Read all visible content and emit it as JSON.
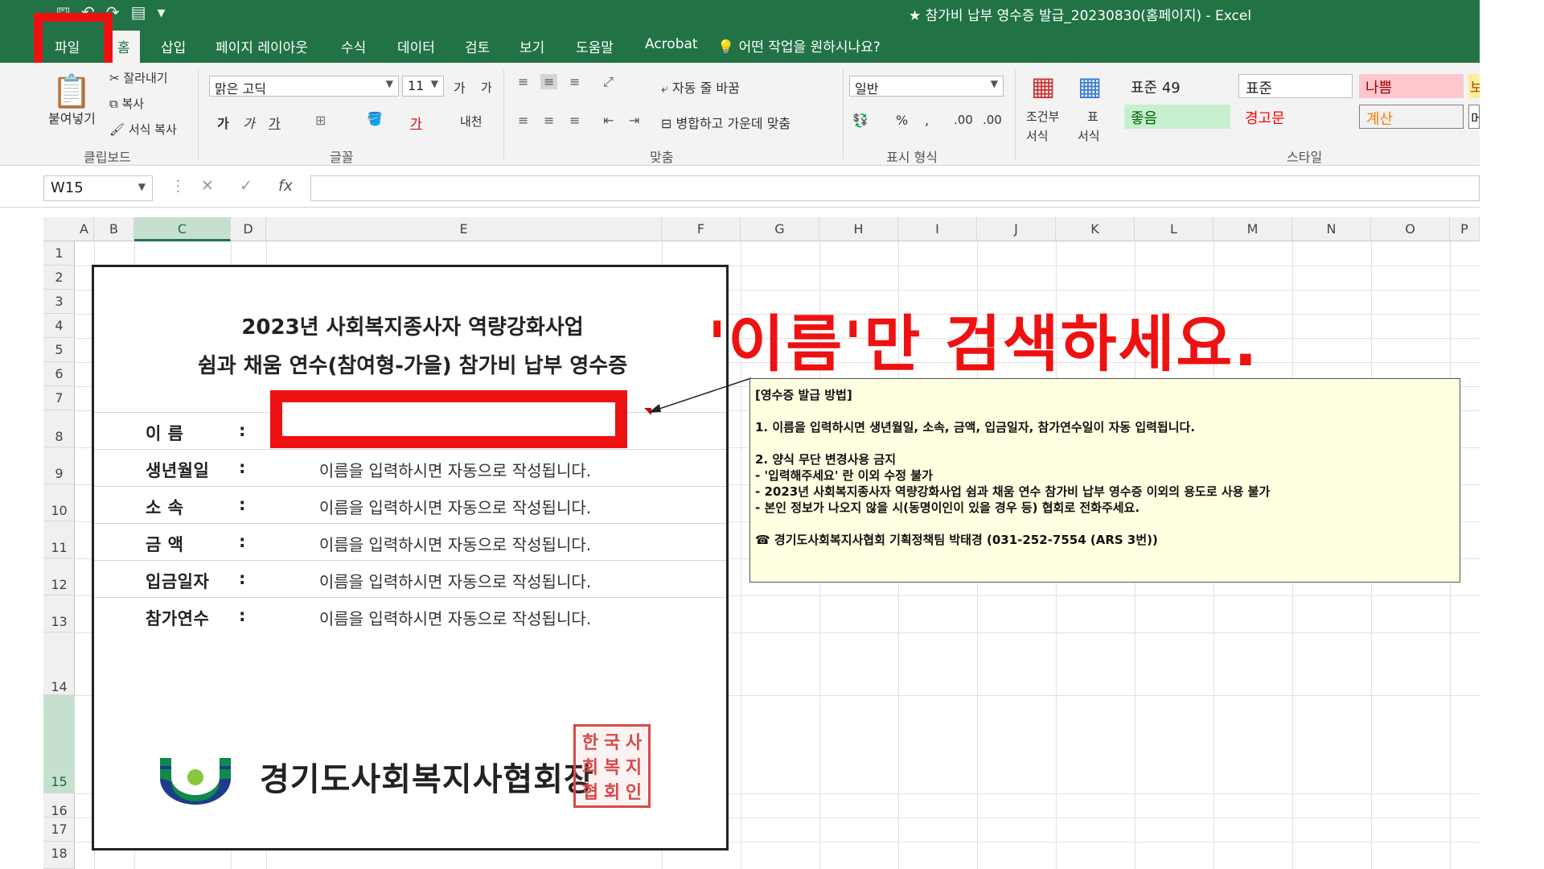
{
  "app": {
    "title": "★ 참가비 납부 영수증 발급_20230830(홈페이지)  -  Excel"
  },
  "tabs": [
    {
      "label": "파일"
    },
    {
      "label": "홈"
    },
    {
      "label": "삽입"
    },
    {
      "label": "페이지 레이아웃"
    },
    {
      "label": "수식"
    },
    {
      "label": "데이터"
    },
    {
      "label": "검토"
    },
    {
      "label": "보기"
    },
    {
      "label": "도움말"
    },
    {
      "label": "Acrobat"
    }
  ],
  "tell_me": "어떤 작업을 원하시나요?",
  "ribbon": {
    "clipboard": {
      "paste": "붙여넣기",
      "cut": "잘라내기",
      "copy": "복사",
      "format_painter": "서식 복사",
      "group": "클립보드"
    },
    "font": {
      "name": "맑은 고딕",
      "size": "11",
      "grow": "가",
      "shrink": "가",
      "bold": "가",
      "italic": "가",
      "underline": "가",
      "font_color": "가",
      "phonetic": "내천",
      "group": "글꼴"
    },
    "alignment": {
      "wrap": "자동 줄 바꿈",
      "merge": "병합하고 가운데 맞춤",
      "group": "맞춤"
    },
    "number": {
      "format": "일반",
      "percent": "%",
      "comma": ",",
      "increase_decimal": ".00",
      "decrease_decimal": ".00",
      "group": "표시 형식"
    },
    "styles": {
      "conditional": "조건부",
      "conditional2": "서식",
      "table": "표",
      "table2": "서식",
      "group": "스타일",
      "cells": [
        {
          "label": "표준 49",
          "bg": "#f3f3f3",
          "fg": "#333333"
        },
        {
          "label": "표준",
          "bg": "#ffffff",
          "fg": "#333333"
        },
        {
          "label": "나쁨",
          "bg": "#ffc7ce",
          "fg": "#9c0006"
        },
        {
          "label": "보",
          "bg": "#ffeb9c",
          "fg": "#9c5700"
        },
        {
          "label": "좋음",
          "bg": "#c6efce",
          "fg": "#006100"
        },
        {
          "label": "경고문",
          "bg": "#f3f3f3",
          "fg": "#ff0000"
        },
        {
          "label": "계산",
          "bg": "#f2f2f2",
          "fg": "#fa7d00"
        },
        {
          "label": "메",
          "bg": "#ffffff",
          "fg": "#333333"
        }
      ]
    }
  },
  "formula_bar": {
    "cell_ref": "W15",
    "cancel": "✕",
    "enter": "✓",
    "fx": "fx",
    "value": ""
  },
  "columns": [
    "A",
    "B",
    "C",
    "D",
    "E",
    "F",
    "G",
    "H",
    "I",
    "J",
    "K",
    "L",
    "M",
    "N",
    "O",
    "P"
  ],
  "rows": [
    "1",
    "2",
    "3",
    "4",
    "5",
    "6",
    "7",
    "8",
    "9",
    "10",
    "11",
    "12",
    "13",
    "14",
    "15",
    "16",
    "17",
    "18"
  ],
  "selected": {
    "column": "C",
    "row": "15"
  },
  "receipt": {
    "title1": "2023년 사회복지종사자 역량강화사업",
    "title2": "쉼과 채움 연수(참여형-가을) 참가비 납부 영수증",
    "fields": [
      {
        "label": "이    름",
        "colon": ":",
        "value": ""
      },
      {
        "label": "생년월일",
        "colon": ":",
        "value": "이름을 입력하시면 자동으로 작성됩니다."
      },
      {
        "label": "소    속",
        "colon": ":",
        "value": "이름을 입력하시면 자동으로 작성됩니다."
      },
      {
        "label": "금    액",
        "colon": ":",
        "value": "이름을 입력하시면 자동으로 작성됩니다."
      },
      {
        "label": "입금일자",
        "colon": ":",
        "value": "이름을 입력하시면 자동으로 작성됩니다."
      },
      {
        "label": "참가연수",
        "colon": ":",
        "value": "이름을 입력하시면 자동으로 작성됩니다."
      }
    ],
    "association": "경기도사회복지사협회장",
    "seal_text": [
      "한",
      "국",
      "사",
      "회",
      "복",
      "지",
      "협",
      "회",
      "인"
    ],
    "logo_colors": {
      "green": "#0e8a4a",
      "blue": "#1f3b8c",
      "dot": "#8cc63f"
    }
  },
  "callout": {
    "headline": "'이름'만 검색하세요.",
    "note": {
      "heading": "[영수증 발급 방법]",
      "line1": "1. 이름을 입력하시면 생년월일, 소속, 금액, 입금일자, 참가연수일이 자동 입력됩니다.",
      "line2": "2. 양식 무단 변경사용 금지",
      "line3": " - '입력해주세요' 란 이외 수정 불가",
      "line4": " - 2023년 사회복지종사자 역량강화사업 쉼과 채움 연수 참가비 납부 영수증 이외의 용도로 사용 불가",
      "line5": " - 본인 정보가 나오지 않을 시(동명이인이 있을 경우 등) 협회로 전화주세요.",
      "contact": "☎ 경기도사회복지사협회 기획정책팀 박태경 (031-252-7554 (ARS 3번))"
    }
  },
  "colors": {
    "excel_green": "#217346",
    "highlight_red": "#ee1111",
    "note_bg": "#ffffe1"
  }
}
